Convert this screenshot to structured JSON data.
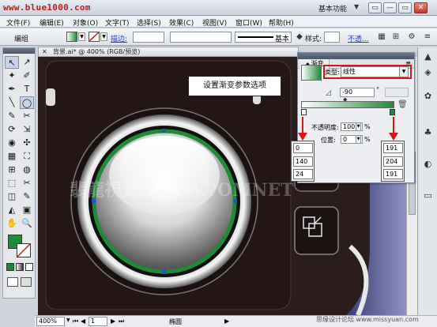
{
  "titlebar": {
    "watermark": "www.blue1000.com",
    "workspace": "基本功能",
    "workspace_arrow": "▼",
    "buttons": [
      "▭",
      "—",
      "▭",
      "✕"
    ]
  },
  "menubar": {
    "items": [
      "文件(F)",
      "编辑(E)",
      "对象(O)",
      "文字(T)",
      "选择(S)",
      "效果(C)",
      "视图(V)",
      "窗口(W)",
      "帮助(H)"
    ]
  },
  "controlbar": {
    "group_label": "编组",
    "stroke_label": "描边:",
    "style_label": "基本",
    "style2_label": "样式:",
    "opacity_link": "不透...",
    "icon_grid": "▦",
    "icon_link": "⚙"
  },
  "document": {
    "tab_title": "背景.ai* @ 400% (RGB/预览)",
    "close": "✕",
    "zoom": "400%",
    "page": "1",
    "status_mode": "椭圆",
    "brand_watermark": "思缘设计论坛 www.missyuan.com"
  },
  "canvas": {
    "watermark": "翡龍視覺 WWW.?OMNET",
    "callout": "设置渐变参数选项",
    "accent_green": "#1f8a3a",
    "bg_color": "#2a1d1c"
  },
  "gradient_panel": {
    "tab": "渐变",
    "type_label": "类型:",
    "type_value": "线性",
    "angle_value": "-90",
    "angle_unit": "°",
    "opacity_label": "不透明度:",
    "opacity_value": "100",
    "position_label": "位置:",
    "position_value": "0",
    "percent": "%",
    "trash_icon": "🗑"
  },
  "color_boxes": {
    "left": [
      "0",
      "140",
      "24"
    ],
    "right": [
      "191",
      "204",
      "191"
    ]
  },
  "tools": {
    "icons": [
      "↖",
      "↗",
      "✦",
      "✐",
      "✒",
      "T",
      "╲",
      "◯",
      "✎",
      "✂",
      "⟳",
      "⇲",
      "◉",
      "✣",
      "▦",
      "⛶",
      "⊞",
      "◍",
      "✋",
      "🔍"
    ],
    "fill_color": "#1f8a3a"
  },
  "right_dock": {
    "icons": [
      "▲",
      "◈",
      "✿",
      "♣",
      "◐",
      "▭"
    ]
  }
}
